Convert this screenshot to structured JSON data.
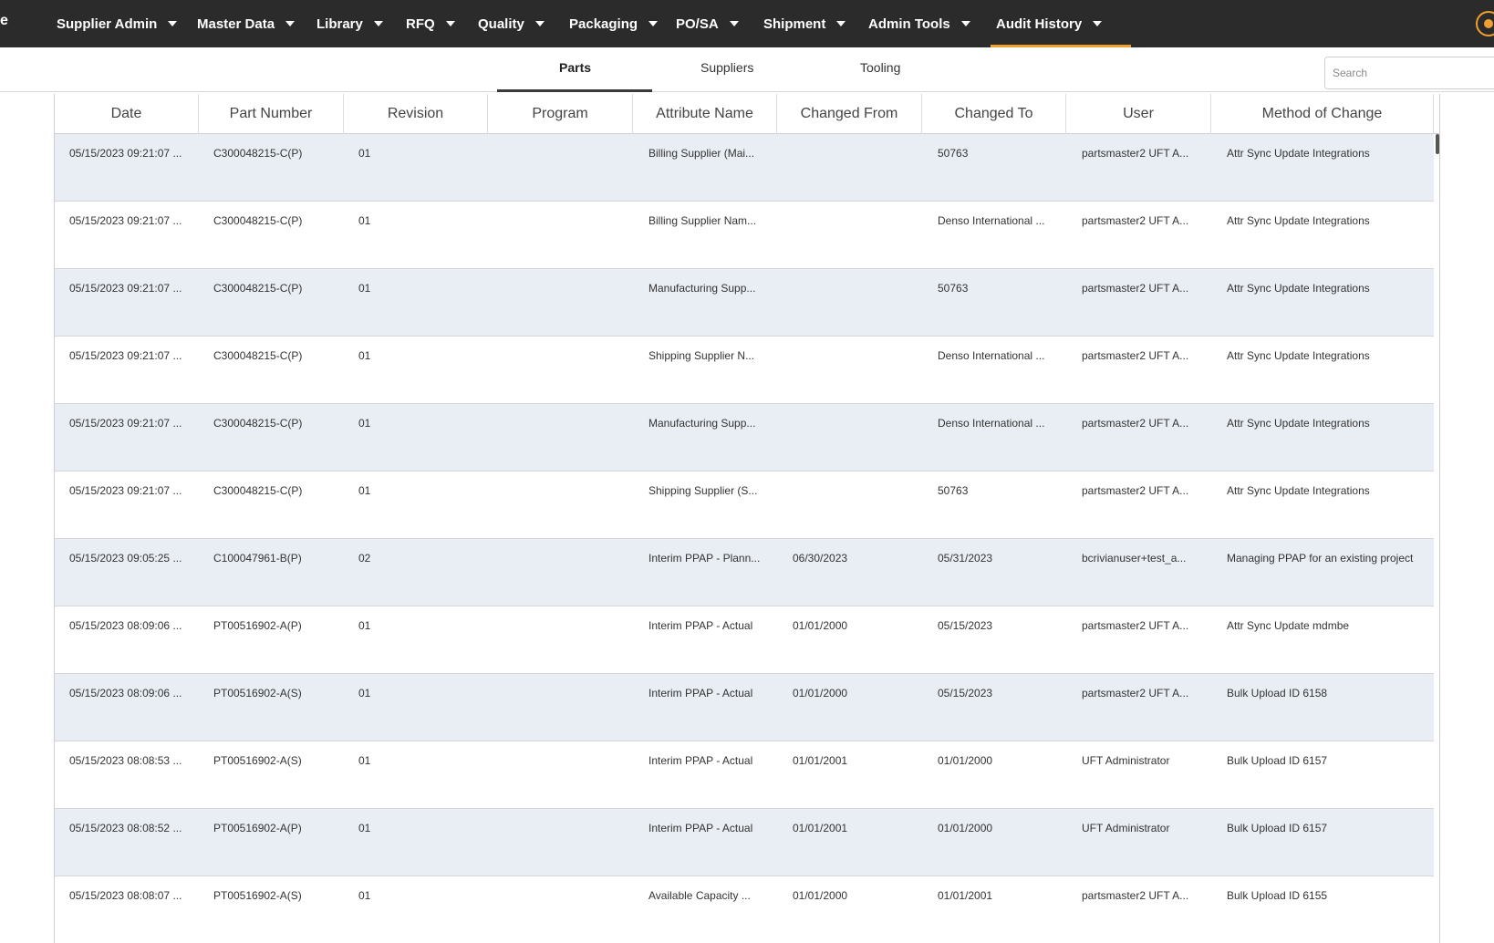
{
  "nav": {
    "brand_tail": "e",
    "items": [
      {
        "label": "Supplier Admin"
      },
      {
        "label": "Master Data"
      },
      {
        "label": "Library"
      },
      {
        "label": "RFQ"
      },
      {
        "label": "Quality"
      },
      {
        "label": "Packaging"
      },
      {
        "label": "PO/SA"
      },
      {
        "label": "Shipment"
      },
      {
        "label": "Admin Tools"
      },
      {
        "label": "Audit History"
      }
    ],
    "active": "Audit History",
    "accent_color": "#f0a030"
  },
  "subtabs": {
    "items": [
      {
        "label": "Parts"
      },
      {
        "label": "Suppliers"
      },
      {
        "label": "Tooling"
      }
    ],
    "active": "Parts"
  },
  "search": {
    "placeholder": "Search"
  },
  "grid": {
    "columns": [
      "Date",
      "Part Number",
      "Revision",
      "Program",
      "Attribute Name",
      "Changed From",
      "Changed To",
      "User",
      "Method of Change"
    ],
    "rows": [
      {
        "date": "05/15/2023 09:21:07 ...",
        "part": "C300048215-C(P)",
        "rev": "01",
        "program": "",
        "attr": "Billing Supplier (Mai...",
        "from": "",
        "to": "50763",
        "user": "partsmaster2 UFT A...",
        "method": "Attr Sync Update Integrations"
      },
      {
        "date": "05/15/2023 09:21:07 ...",
        "part": "C300048215-C(P)",
        "rev": "01",
        "program": "",
        "attr": "Billing Supplier Nam...",
        "from": "",
        "to": "Denso International ...",
        "user": "partsmaster2 UFT A...",
        "method": "Attr Sync Update Integrations"
      },
      {
        "date": "05/15/2023 09:21:07 ...",
        "part": "C300048215-C(P)",
        "rev": "01",
        "program": "",
        "attr": "Manufacturing Supp...",
        "from": "",
        "to": "50763",
        "user": "partsmaster2 UFT A...",
        "method": "Attr Sync Update Integrations"
      },
      {
        "date": "05/15/2023 09:21:07 ...",
        "part": "C300048215-C(P)",
        "rev": "01",
        "program": "",
        "attr": "Shipping Supplier N...",
        "from": "",
        "to": "Denso International ...",
        "user": "partsmaster2 UFT A...",
        "method": "Attr Sync Update Integrations"
      },
      {
        "date": "05/15/2023 09:21:07 ...",
        "part": "C300048215-C(P)",
        "rev": "01",
        "program": "",
        "attr": "Manufacturing Supp...",
        "from": "",
        "to": "Denso International ...",
        "user": "partsmaster2 UFT A...",
        "method": "Attr Sync Update Integrations"
      },
      {
        "date": "05/15/2023 09:21:07 ...",
        "part": "C300048215-C(P)",
        "rev": "01",
        "program": "",
        "attr": "Shipping Supplier (S...",
        "from": "",
        "to": "50763",
        "user": "partsmaster2 UFT A...",
        "method": "Attr Sync Update Integrations"
      },
      {
        "date": "05/15/2023 09:05:25 ...",
        "part": "C100047961-B(P)",
        "rev": "02",
        "program": "",
        "attr": "Interim PPAP - Plann...",
        "from": "06/30/2023",
        "to": "05/31/2023",
        "user": "bcrivianuser+test_a...",
        "method": "Managing PPAP for an existing project"
      },
      {
        "date": "05/15/2023 08:09:06 ...",
        "part": "PT00516902-A(P)",
        "rev": "01",
        "program": "",
        "attr": "Interim PPAP - Actual",
        "from": "01/01/2000",
        "to": "05/15/2023",
        "user": "partsmaster2 UFT A...",
        "method": "Attr Sync Update mdmbe"
      },
      {
        "date": "05/15/2023 08:09:06 ...",
        "part": "PT00516902-A(S)",
        "rev": "01",
        "program": "",
        "attr": "Interim PPAP - Actual",
        "from": "01/01/2000",
        "to": "05/15/2023",
        "user": "partsmaster2 UFT A...",
        "method": "Bulk Upload ID 6158"
      },
      {
        "date": "05/15/2023 08:08:53 ...",
        "part": "PT00516902-A(S)",
        "rev": "01",
        "program": "",
        "attr": "Interim PPAP - Actual",
        "from": "01/01/2001",
        "to": "01/01/2000",
        "user": "UFT Administrator",
        "method": "Bulk Upload ID 6157"
      },
      {
        "date": "05/15/2023 08:08:52 ...",
        "part": "PT00516902-A(P)",
        "rev": "01",
        "program": "",
        "attr": "Interim PPAP - Actual",
        "from": "01/01/2001",
        "to": "01/01/2000",
        "user": "UFT Administrator",
        "method": "Bulk Upload ID 6157"
      },
      {
        "date": "05/15/2023 08:08:07 ...",
        "part": "PT00516902-A(S)",
        "rev": "01",
        "program": "",
        "attr": "Available Capacity ...",
        "from": "01/01/2000",
        "to": "01/01/2001",
        "user": "partsmaster2 UFT A...",
        "method": "Bulk Upload ID 6155"
      }
    ]
  }
}
